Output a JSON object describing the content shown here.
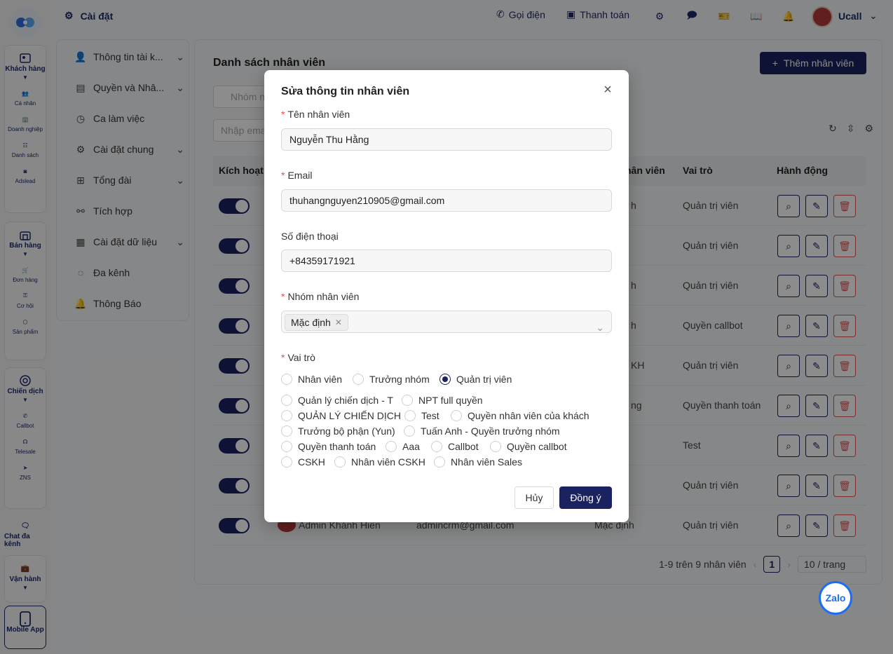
{
  "rail": {
    "groups": [
      {
        "label": "Khách hàng",
        "items": [
          "Cá nhân",
          "Doanh nghiệp",
          "Danh sách",
          "Adslead"
        ]
      },
      {
        "label": "Bán hàng",
        "items": [
          "Đơn hàng",
          "Cơ hội",
          "Sản phẩm"
        ]
      },
      {
        "label": "Chiến dịch",
        "items": [
          "Callbot",
          "Telesale",
          "ZNS"
        ]
      }
    ],
    "chat": "Chat đa kênh",
    "ops": "Vận hành",
    "mobile": "Mobile App"
  },
  "header": {
    "title": "Cài đặt",
    "call": "Gọi điện",
    "payment": "Thanh toán",
    "user": "Ucall"
  },
  "menu": {
    "items": [
      "Thông tin tài k...",
      "Quyền và Nhâ...",
      "Ca làm việc",
      "Cài đặt chung",
      "Tổng đài",
      "Tích hợp",
      "Cài đặt dữ liệu",
      "Đa kênh",
      "Thông Báo"
    ]
  },
  "main": {
    "title": "Danh sách nhân viên",
    "add_button": "Thêm nhân viên",
    "filter_group_placeholder": "Nhóm n",
    "filter_email_placeholder": "Nhập ema",
    "columns": {
      "active": "Kích hoạt",
      "name": "hân viên",
      "role": "Vai trò",
      "actions": "Hành động"
    },
    "rows": [
      {
        "group": "h",
        "role": "Quản trị viên"
      },
      {
        "group": "",
        "role": "Quản trị viên"
      },
      {
        "group": "h",
        "role": "Quản trị viên"
      },
      {
        "group": "h",
        "role": "Quyền callbot"
      },
      {
        "group": "KH",
        "role": "Quản trị viên"
      },
      {
        "group": "ng",
        "role": "Quyền thanh toán"
      },
      {
        "group": "",
        "role": "Test"
      },
      {
        "group": "",
        "role": "Quản trị viên"
      },
      {
        "group": "Mặc định",
        "role": "Quản trị viên",
        "name": "Admin Khánh Hiền",
        "email": "admincrm@gmail.com"
      }
    ],
    "pagination": {
      "summary": "1-9 trên 9 nhân viên",
      "page": "1",
      "page_size": "10 / trang"
    }
  },
  "zalo": "Zalo",
  "modal": {
    "title": "Sửa thông tin nhân viên",
    "name_label": "Tên nhân viên",
    "name_value": "Nguyễn Thu Hằng",
    "email_label": "Email",
    "email_value": "thuhangnguyen210905@gmail.com",
    "phone_label": "Số điện thoại",
    "phone_value": "+84359171921",
    "group_label": "Nhóm nhân viên",
    "group_tag": "Mặc định",
    "role_label": "Vai trò",
    "roles": [
      "Nhân viên",
      "Trưởng nhóm",
      "Quản trị viên",
      "Quản lý chiến dịch - T",
      "NPT full quyền",
      "QUẢN LÝ CHIẾN DỊCH",
      "Test",
      "Quyền nhân viên của khách",
      "Trưởng bộ phận (Yun)",
      "Tuấn Anh - Quyền trưởng nhóm",
      "Quyền thanh toán",
      "Aaa",
      "Callbot",
      "Quyền callbot",
      "CSKH",
      "Nhân viên CSKH",
      "Nhân viên Sales"
    ],
    "selected_role": "Quản trị viên",
    "cancel": "Hủy",
    "ok": "Đồng ý"
  }
}
